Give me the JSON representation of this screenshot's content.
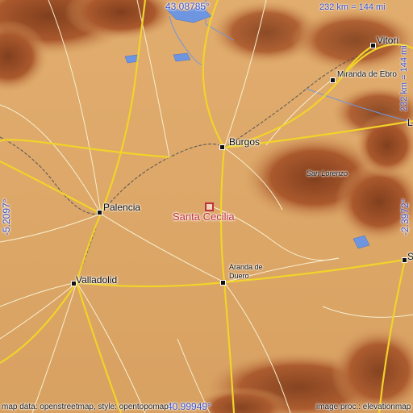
{
  "map": {
    "colors": {
      "lowland": "#d9a467",
      "highland": "#a8552a",
      "peak": "#7d3a1a",
      "water": "#6e95e0",
      "road_major": "#f1d32a",
      "road_minor": "#f7f0cf",
      "rail": "#555555",
      "target": "#c0303c",
      "coord_text": "#3a4fc4"
    },
    "target": {
      "name": "Santa Cecilia",
      "icon": "square-marker-icon"
    },
    "places": {
      "burgos": "Burgos",
      "palencia": "Palencia",
      "valladolid": "Valladolid",
      "aranda": "Aranda de\nDuero",
      "vitoria": "Vitori",
      "miranda": "Miranda de Ebro",
      "san_lorenzo": "San Lorenzo",
      "soria_edge": "S",
      "right_edge_upper": "L"
    },
    "coords": {
      "top": "43.08785°",
      "bottom": "40.99949°",
      "left": "-5.2097°",
      "right": "-2.3972°"
    },
    "scale": {
      "horizontal": "232 km = 144 mi",
      "vertical": "232 km = 144 mi"
    },
    "credits": {
      "left": "map data: openstreetmap, style: opentopomap",
      "right": "image proc.: elevationmap"
    }
  }
}
